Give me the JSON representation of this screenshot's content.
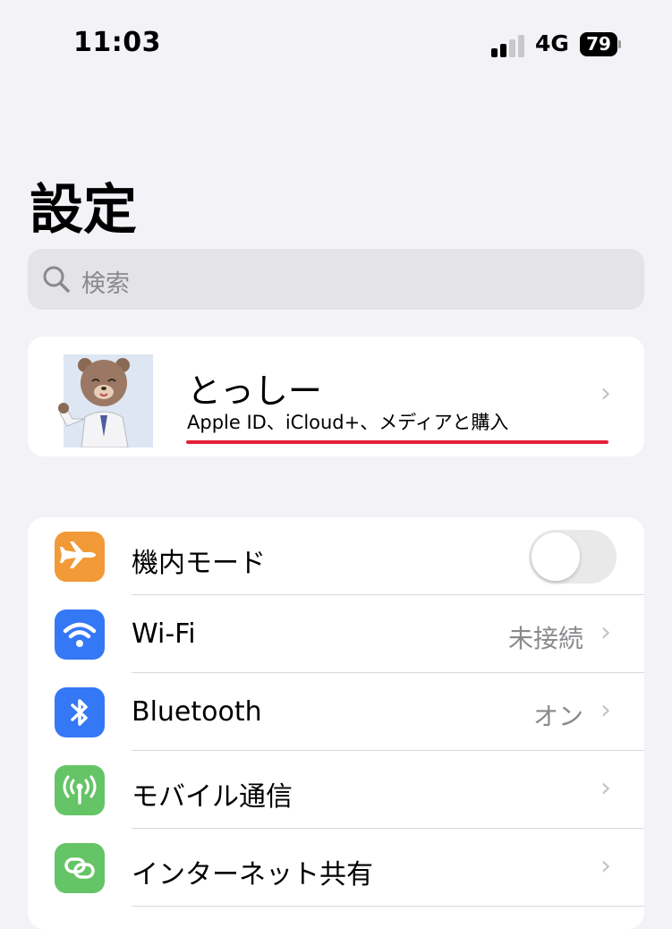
{
  "status_bar": {
    "time": "11:03",
    "network": "4G",
    "battery": "79"
  },
  "page": {
    "title": "設定"
  },
  "search": {
    "placeholder": "検索"
  },
  "profile": {
    "name": "とっしー",
    "subtitle": "Apple ID、iCloud+、メディアと購入"
  },
  "settings": [
    {
      "label": "機内モード",
      "icon": "airplane-icon",
      "color": "#f19a37",
      "toggle": false
    },
    {
      "label": "Wi-Fi",
      "value": "未接続",
      "icon": "wifi-icon",
      "color": "#3478f6"
    },
    {
      "label": "Bluetooth",
      "value": "オン",
      "icon": "bluetooth-icon",
      "color": "#3478f6"
    },
    {
      "label": "モバイル通信",
      "icon": "cellular-antenna-icon",
      "color": "#65c466"
    },
    {
      "label": "インターネット共有",
      "icon": "personal-hotspot-icon",
      "color": "#65c466"
    }
  ]
}
